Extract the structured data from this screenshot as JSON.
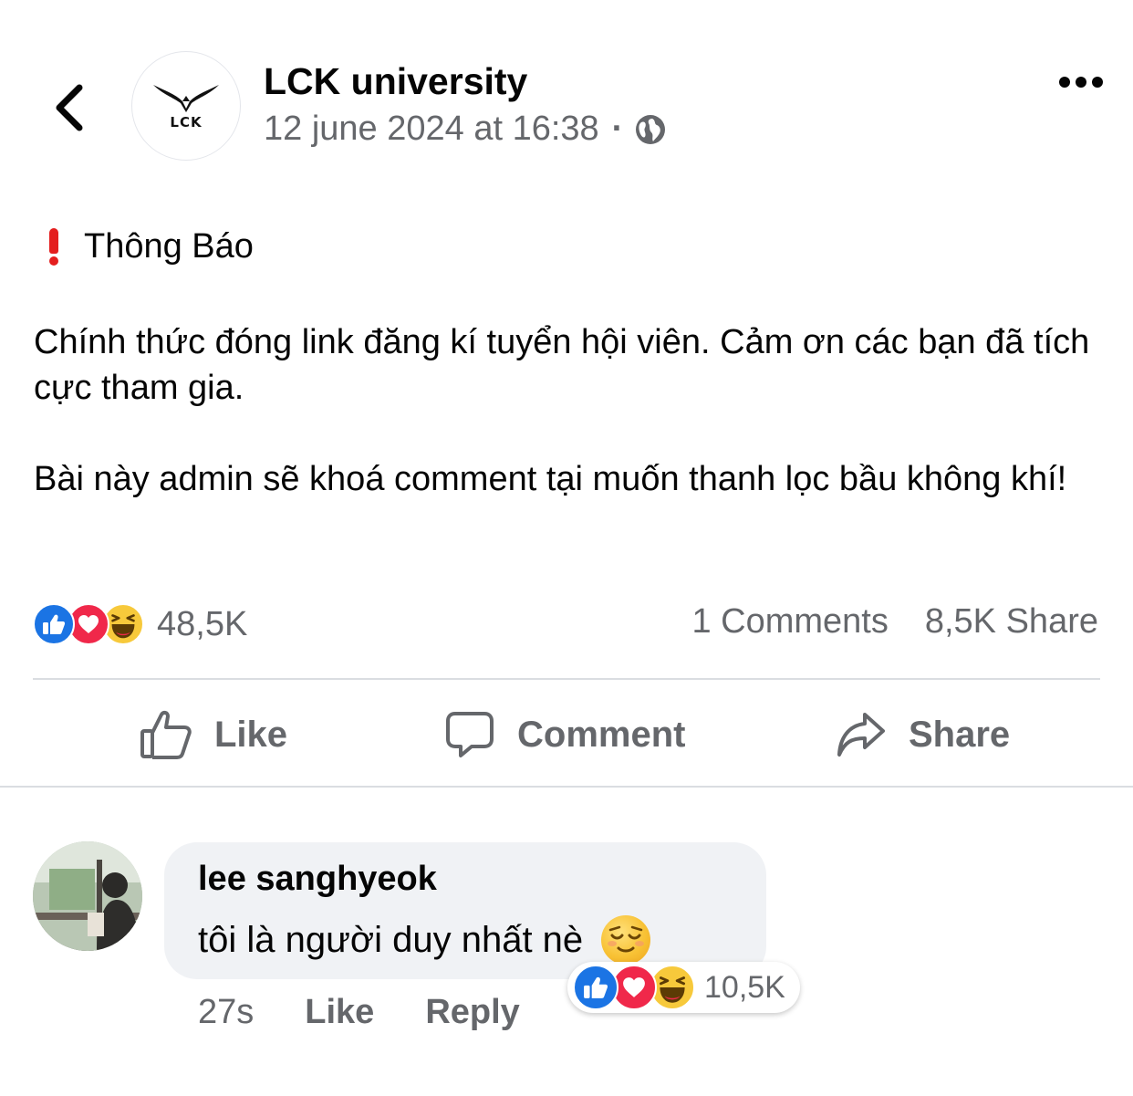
{
  "header": {
    "back_icon": "chevron-left-icon",
    "page_name": "LCK university",
    "avatar_logo_text": "LCK",
    "timestamp": "12 june 2024 at 16:38",
    "separator": "·",
    "privacy_icon": "globe-icon",
    "more_icon": "more-dots-icon"
  },
  "post": {
    "heading_icon": "red-exclamation-icon",
    "heading": "Thông Báo",
    "paragraphs": [
      "Chính thức đóng link đăng kí tuyển hội viên. Cảm ơn các bạn đã tích cực tham gia.",
      "Bài này admin sẽ khoá comment tại muốn thanh lọc bầu không khí!"
    ]
  },
  "stats": {
    "reaction_icons": [
      "like-reaction-icon",
      "love-reaction-icon",
      "haha-reaction-icon"
    ],
    "reactions_count": "48,5K",
    "comments": "1 Comments",
    "shares": "8,5K Share"
  },
  "actions": {
    "like": "Like",
    "comment": "Comment",
    "share": "Share"
  },
  "comment": {
    "author": "lee sanghyeok",
    "text": "tôi là người duy nhất nè",
    "emoji": "relieved-face-emoji",
    "time": "27s",
    "like": "Like",
    "reply": "Reply",
    "reactions_count": "10,5K"
  },
  "colors": {
    "text": "#050505",
    "secondary": "#65676b",
    "divider": "#dadde1",
    "bubble": "#f0f2f5",
    "like_blue": "#1b74e4",
    "love_red": "#f0284a",
    "haha_yellow": "#f7c93b",
    "alert_red": "#e41e1e"
  }
}
